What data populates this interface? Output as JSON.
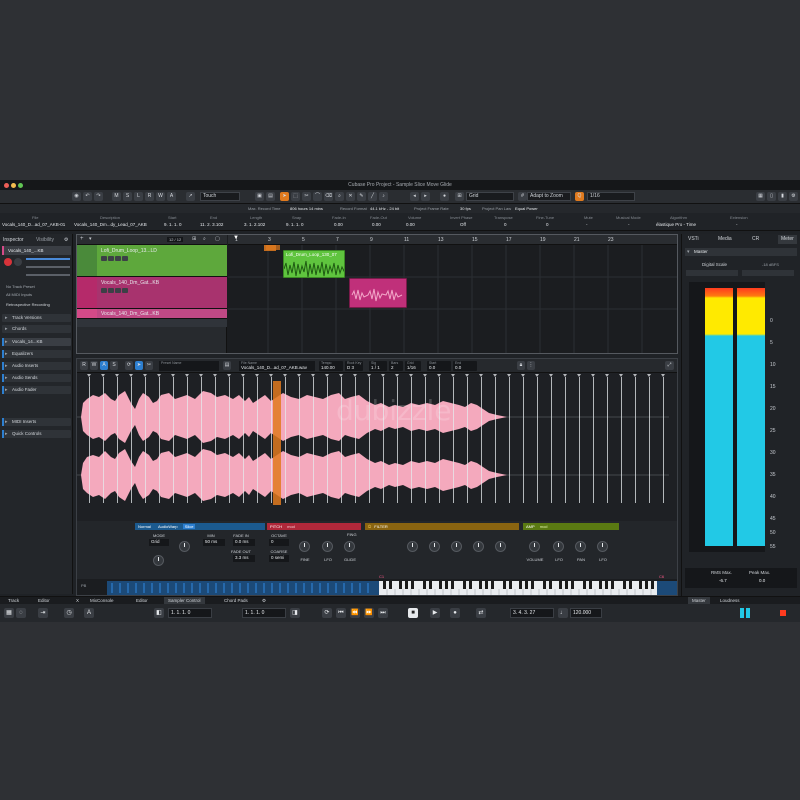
{
  "window": {
    "title": "Cubase Pro Project - Sample Slice Move Glide"
  },
  "toolbar": {
    "transport_letters": [
      "M",
      "S",
      "L",
      "R",
      "W",
      "A"
    ],
    "automation_mode": "Touch",
    "snap_type": "Grid",
    "zoom_mode": "Adapt to Zoom",
    "quantize": "1/16"
  },
  "status_line": {
    "max_record_time": "Max. Record Time",
    "record_time_value": "806 hours 14 mins",
    "record_format": "Record Format",
    "record_format_value": "44.1 kHz - 24 bit",
    "frame_rate": "Project Frame Rate",
    "frame_rate_value": "30 fps",
    "pan_law": "Project Pan Law",
    "pan_law_value": "Equal Power"
  },
  "info_line": {
    "headers": [
      "File",
      "Description",
      "Start",
      "End",
      "Length",
      "Snap",
      "Fade-In",
      "Fade-Out",
      "Volume",
      "Invert Phase",
      "Transpose",
      "Fine-Tune",
      "Mute",
      "Musical Mode",
      "Algorithm",
      "Extension"
    ],
    "values": [
      "Vocals_140_D...ad_07_AKB-01",
      "Vocals_140_Dm...dy_Lead_07_AKB",
      "9. 1. 1. 0",
      "11. 2. 3.102",
      "3. 1. 2.102",
      "9. 1. 1. 0",
      "0.00",
      "0.00",
      "0.00",
      "Off",
      "0",
      "0",
      "-",
      "-",
      "élastique Pro - Time",
      "-"
    ]
  },
  "inspector": {
    "tabs": [
      "Inspector",
      "Visibility"
    ],
    "track_name": "Vocals_140_...KB",
    "input_label": "No Track Preset",
    "midi_inputs": "All MIDI Inputs",
    "retro_label": "Retrospective Recording",
    "sections": [
      "Track Versions",
      "Chords",
      "Vocals_14...KB",
      "Equalizers",
      "Audio Inserts",
      "Audio Sends",
      "Audio Fader",
      "MIDI Inserts",
      "Quick Controls"
    ]
  },
  "project": {
    "zoom_readout": "12 / 12",
    "ruler_marks": [
      "1",
      "3",
      "5",
      "7",
      "9",
      "11",
      "13",
      "15",
      "17",
      "19",
      "21",
      "23"
    ],
    "tracks": [
      {
        "name": "Lofi_Drum_Loop_13...LD",
        "color": "#4a8a3a"
      },
      {
        "name": "Vocals_140_Dm_Gat...KB",
        "color": "#b52a6a"
      },
      {
        "name": "Vocals_140_Dm_Gat...KB",
        "color": "#d44a88"
      }
    ],
    "clips": [
      {
        "label": "Lofi_Drum_Loop_130_07",
        "color": "#5fc43e"
      },
      {
        "label": "",
        "color": "#c0307a"
      }
    ]
  },
  "sampler": {
    "preset_label": "Preset Name",
    "file_label": "File Name",
    "file_name": "Vocals_140_D...ad_07_AKB.wav",
    "fields": [
      {
        "k": "Tempo",
        "v": "140.00"
      },
      {
        "k": "Root Key",
        "v": "D 3"
      },
      {
        "k": "Sig",
        "v": "1 / 1"
      },
      {
        "k": "Bars",
        "v": "2"
      },
      {
        "k": "Grid",
        "v": "1/16"
      },
      {
        "k": "Start",
        "v": "0.0"
      },
      {
        "k": "End",
        "v": "0.0"
      }
    ],
    "section_bars": {
      "normal": "Normal",
      "audiowarp": "AudioWarp",
      "slice": "Slice",
      "pitch": "PITCH",
      "filter": "FILTER",
      "amp": "AMP",
      "mod": "mod"
    },
    "controls": {
      "mode_label": "MODE",
      "mode_value": "Grid",
      "min_length_label": "MIN LENGTH",
      "min_length_value": "50 ms",
      "fade_in_label": "FADE IN",
      "fade_in_value": "0.0 ms",
      "fade_out_label": "FADE OUT",
      "fade_out_value": "3.3 ms",
      "octave_label": "OCTAVE",
      "octave_value": "0",
      "coarse_label": "COARSE",
      "coarse_value": "0 semi",
      "fine": "FINE",
      "lfo": "LFO",
      "glide": "GLIDE",
      "fing": "FING",
      "volume": "VOLUME",
      "pan": "PAN",
      "lfo2": "LFO",
      "lfo3": "LFO"
    },
    "keyboard": {
      "low": "C1",
      "high": "C6"
    }
  },
  "right_zone": {
    "tabs": [
      "VSTi",
      "Media",
      "CR",
      "Meter"
    ],
    "master_label": "Master",
    "digital_scale_label": "Digital Scale",
    "digital_scale_value": "-18 dBFS",
    "scale": [
      "0",
      "5",
      "10",
      "15",
      "20",
      "25",
      "30",
      "35",
      "40",
      "45",
      "50",
      "55"
    ],
    "rms_label": "RMS Max.",
    "rms_value": "-6.7",
    "peak_label": "Peak Max.",
    "peak_value": "0.0",
    "bottom_tabs": [
      "Master",
      "Loudness"
    ]
  },
  "bottom_tabs": [
    "Track",
    "Editor",
    "X",
    "MixConsole",
    "Editor",
    "Sampler Control",
    "Chord Pads"
  ],
  "transport": {
    "left_locator": "1. 1. 1. 0",
    "right_locator": "1. 1. 1. 0",
    "position": "3. 4. 3. 27",
    "tempo": "120.000"
  },
  "colors": {
    "accent": "#e07a1e",
    "wave": "#f4a9bd",
    "meter_cyan": "#22c9e6",
    "meter_yellow": "#ffea00"
  }
}
